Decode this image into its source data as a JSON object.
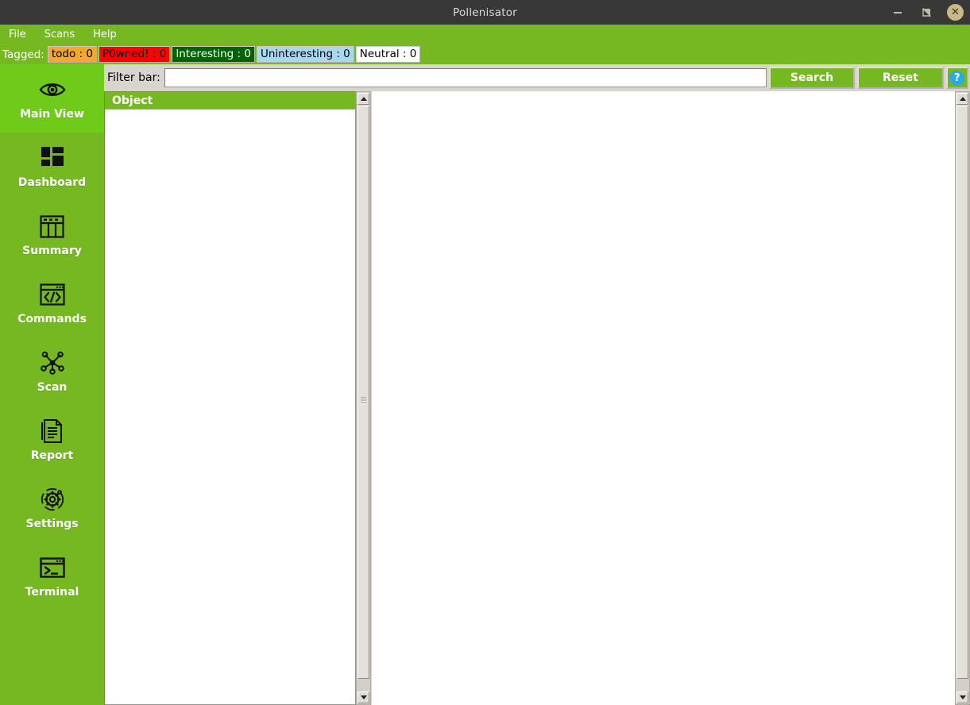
{
  "window": {
    "title": "Pollenisator",
    "controls": {
      "minimize_name": "minimize",
      "maximize_name": "maximize",
      "close_name": "close",
      "close_glyph": "✕"
    }
  },
  "menubar": {
    "items": [
      {
        "label": "File"
      },
      {
        "label": "Scans"
      },
      {
        "label": "Help"
      }
    ]
  },
  "tagbar": {
    "label": "Tagged:",
    "tags": [
      {
        "label": "todo : 0",
        "bg": "#f0a830",
        "fg": "#000000"
      },
      {
        "label": "P0wned! : 0",
        "bg": "#ff0000",
        "fg": "#000000"
      },
      {
        "label": "Interesting : 0",
        "bg": "#006400",
        "fg": "#ffffff"
      },
      {
        "label": "Uninteresting : 0",
        "bg": "#a9d7ef",
        "fg": "#000000"
      },
      {
        "label": "Neutral : 0",
        "bg": "#ffffff",
        "fg": "#000000"
      }
    ]
  },
  "sidebar": {
    "active_index": 0,
    "items": [
      {
        "label": "Main View",
        "icon": "eye-icon"
      },
      {
        "label": "Dashboard",
        "icon": "dashboard-grid-icon"
      },
      {
        "label": "Summary",
        "icon": "table-icon"
      },
      {
        "label": "Commands",
        "icon": "code-window-icon"
      },
      {
        "label": "Scan",
        "icon": "network-nodes-icon"
      },
      {
        "label": "Report",
        "icon": "document-icon"
      },
      {
        "label": "Settings",
        "icon": "gear-icon"
      },
      {
        "label": "Terminal",
        "icon": "terminal-icon"
      }
    ]
  },
  "filterbar": {
    "label": "Filter bar:",
    "input_value": "",
    "input_placeholder": "",
    "search_label": "Search",
    "reset_label": "Reset",
    "help_label": "?"
  },
  "tree": {
    "header": "Object",
    "rows": []
  },
  "colors": {
    "brand_green": "#76b821",
    "active_green": "#6ecb1a",
    "help_blue": "#29abe2",
    "titlebar": "#383838",
    "close_button": "#cbb787"
  }
}
